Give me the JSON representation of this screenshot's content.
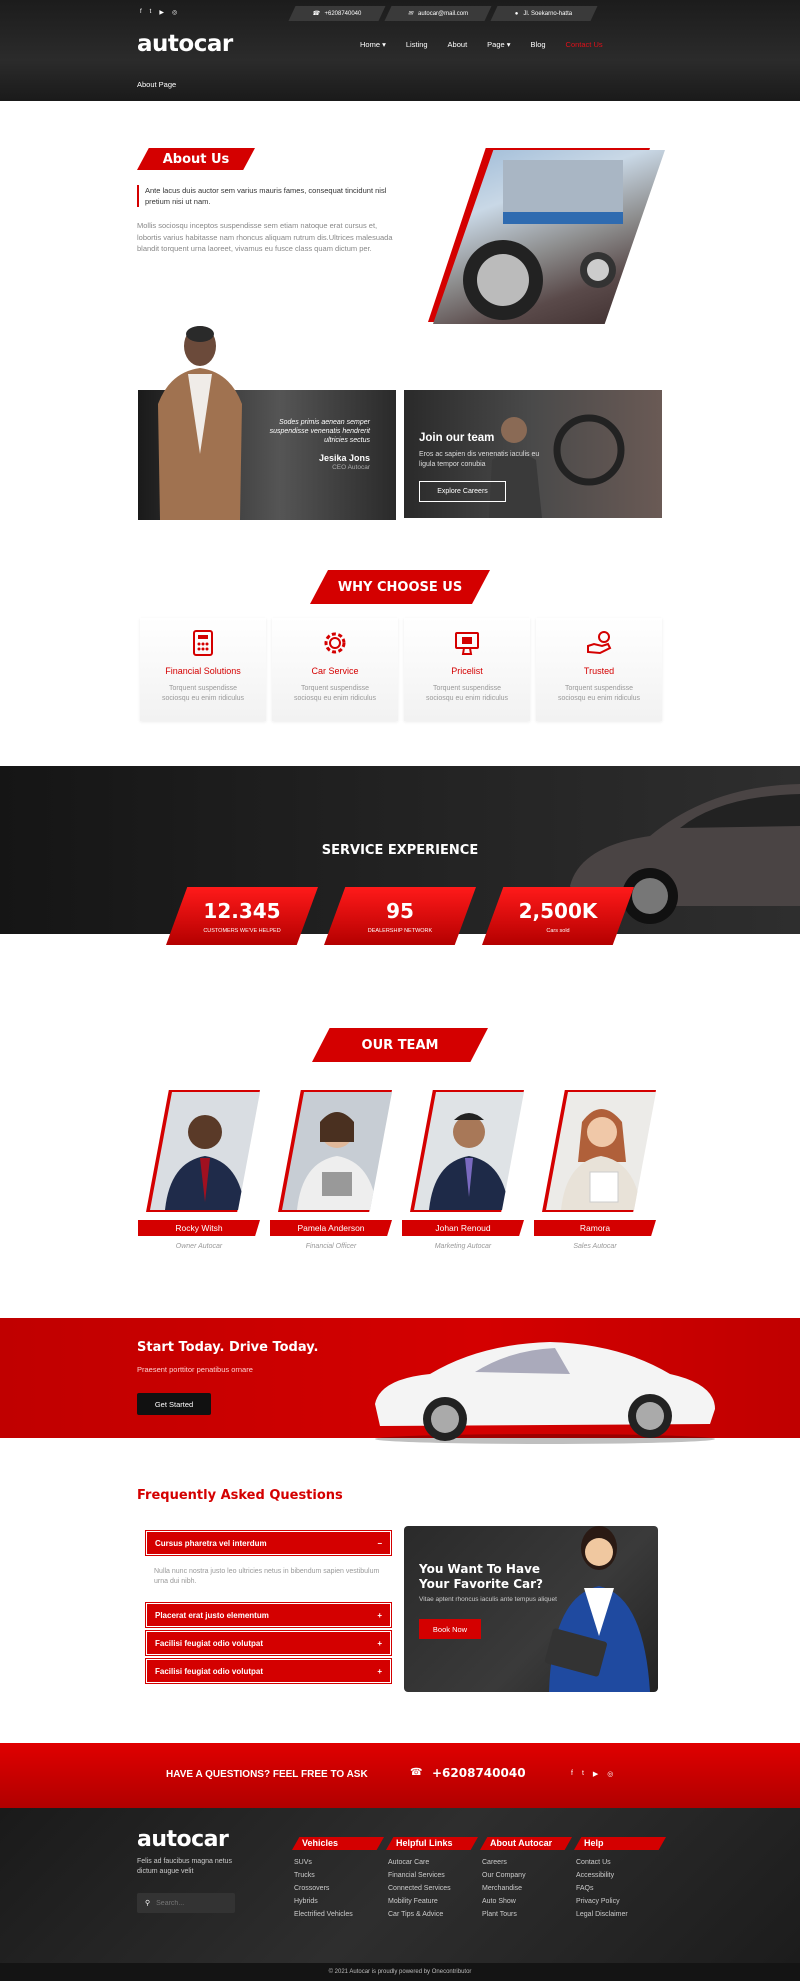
{
  "header": {
    "social": [
      "f",
      "t",
      "▶",
      "◎"
    ],
    "phone": "+6208740040",
    "email": "autocar@mail.com",
    "address": "Jl. Soekarno-hatta",
    "logo": "autocar",
    "nav": [
      "Home ▾",
      "Listing",
      "About",
      "Page ▾",
      "Blog",
      "Contact Us"
    ],
    "breadcrumb": "About Page"
  },
  "about": {
    "title": "About Us",
    "lead": "Ante lacus duis auctor sem varius  mauris fames, consequat tincidunt nisl pretium nisi ut nam.",
    "body": "Mollis sociosqu inceptos suspendisse sem etiam natoque erat cursus et,  lobortis varius habitasse nam rhoncus aliquam rutrum dis.Ultrices malesuada blandit  torquent urna laoreet, vivamus eu fusce class quam dictum per."
  },
  "ceo": {
    "quote": "Sodes primis aenean semper suspendisse venenatis hendrerit ultricies sectus",
    "name": "Jesika Jons",
    "role": "CEO Autocar"
  },
  "join": {
    "title": "Join our team",
    "text": "Eros ac sapien dis venenatis iaculis eu ligula tempor conubia",
    "button": "Explore Careers"
  },
  "why": {
    "title": "WHY CHOOSE US",
    "cards": [
      {
        "icon": "calculator-icon",
        "title": "Financial Solutions",
        "text": "Torquent suspendisse sociosqu eu enim ridiculus"
      },
      {
        "icon": "gear-icon",
        "title": "Car Service",
        "text": "Torquent suspendisse sociosqu eu enim ridiculus"
      },
      {
        "icon": "monitor-icon",
        "title": "Pricelist",
        "text": "Torquent suspendisse sociosqu eu enim ridiculus"
      },
      {
        "icon": "hand-icon",
        "title": "Trusted",
        "text": "Torquent suspendisse sociosqu eu enim ridiculus"
      }
    ]
  },
  "service": {
    "title": "SERVICE EXPERIENCE",
    "stats": [
      {
        "value": "12.345",
        "label": "CUSTOMERS WE'VE HELPED"
      },
      {
        "value": "95",
        "label": "DEALERSHIP NETWORK"
      },
      {
        "value": "2,500K",
        "label": "Cars sold"
      }
    ]
  },
  "team": {
    "title": "OUR TEAM",
    "members": [
      {
        "name": "Rocky Witsh",
        "role": "Owner Autocar"
      },
      {
        "name": "Pamela Anderson",
        "role": "Financial Officer"
      },
      {
        "name": "Johan Renoud",
        "role": "Marketing Autocar"
      },
      {
        "name": "Ramora",
        "role": "Sales Autocar"
      }
    ]
  },
  "cta": {
    "title": "Start Today. Drive Today.",
    "subtitle": "Praesent porttitor penatibus ornare",
    "button": "Get Started"
  },
  "faq": {
    "title": "Frequently Asked Questions",
    "open_q": "Cursus pharetra vel interdum",
    "open_sign": "−",
    "open_a": "Nulla nunc nostra justo leo ultricies netus in bibendum sapien vestibulum urna dui nibh.",
    "items": [
      "Placerat erat justo elementum",
      "Facilisi feugiat odio volutpat",
      "Facilisi feugiat odio volutpat"
    ],
    "plus": "+"
  },
  "promo": {
    "title": "You Want To Have Your Favorite Car?",
    "text": "Vitae aptent rhoncus iaculis ante tempus aliquet",
    "button": "Book Now"
  },
  "contactbar": {
    "text": "HAVE A QUESTIONS? FEEL FREE TO ASK",
    "phone": "+6208740040"
  },
  "footer": {
    "logo": "autocar",
    "tagline": "Felis ad faucibus magna netus dictum augue velit",
    "search_placeholder": "Search...",
    "cols": [
      {
        "title": "Vehicles",
        "links": [
          "SUVs",
          "Trucks",
          "Crossovers",
          "Hybrids",
          "Electrified Vehicles"
        ]
      },
      {
        "title": "Helpful Links",
        "links": [
          "Autocar Care",
          "Financial Services",
          "Connected Services",
          "Mobility Feature",
          "Car Tips & Advice"
        ]
      },
      {
        "title": "About Autocar",
        "links": [
          "Careers",
          "Our Company",
          "Merchandise",
          "Auto Show",
          "Plant Tours"
        ]
      },
      {
        "title": "Help",
        "links": [
          "Contact Us",
          "Accessibility",
          "FAQs",
          "Privacy Policy",
          "Legal Disclaimer"
        ]
      }
    ],
    "copyright": "© 2021 Autocar is proudly powered by Onecontributor"
  },
  "colors": {
    "accent": "#d40000",
    "dark": "#1e1e1e"
  }
}
